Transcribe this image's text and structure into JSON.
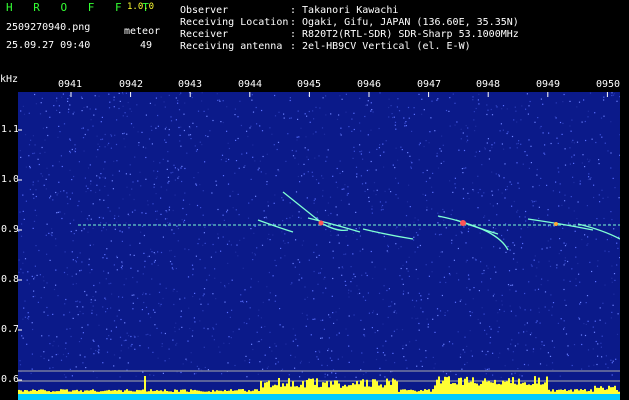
{
  "app": {
    "title": "H R O F F T",
    "version": "1.0.0"
  },
  "capture": {
    "filename": "2509270940.png",
    "datetime": "25.09.27 09:40",
    "meteor_label": "meteor",
    "meteor_count": "49"
  },
  "info": [
    {
      "label": "Observer",
      "value": ": Takanori Kawachi"
    },
    {
      "label": "Receiving Location",
      "value": ": Ogaki, Gifu, JAPAN (136.60E, 35.35N)"
    },
    {
      "label": "Receiver",
      "value": ": R820T2(RTL-SDR) SDR-Sharp 53.1000MHz"
    },
    {
      "label": "Receiving antenna",
      "value": ": 2el-HB9CV Vertical (el. E-W)"
    }
  ],
  "axis": {
    "unit": "kHz",
    "y_ticks": [
      "1.1",
      "1.0",
      "0.9",
      "0.8",
      "0.7",
      "0.6"
    ],
    "x_ticks": [
      "0941",
      "0942",
      "0943",
      "0944",
      "0945",
      "0946",
      "0947",
      "0948",
      "0949",
      "0950"
    ]
  },
  "colors": {
    "background": "#0b1a8a",
    "noise": "#3a4fd6",
    "trace": "#7fffd4",
    "level_bar": "#ffff33",
    "baseline": "#00ccff"
  }
}
